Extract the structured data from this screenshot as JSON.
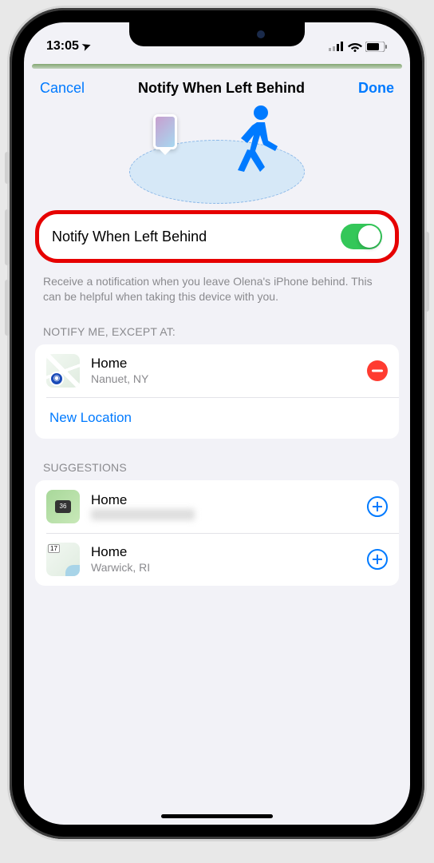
{
  "status": {
    "time": "13:05",
    "location_glyph": "➤"
  },
  "nav": {
    "cancel": "Cancel",
    "title": "Notify When Left Behind",
    "done": "Done"
  },
  "main_toggle": {
    "label": "Notify When Left Behind",
    "on": true
  },
  "helper_text": "Receive a notification when you leave Olena's iPhone behind. This can be helpful when taking this device with you.",
  "sections": {
    "except_header": "NOTIFY ME, EXCEPT AT:",
    "suggestions_header": "SUGGESTIONS"
  },
  "except": [
    {
      "title": "Home",
      "subtitle": "Nanuet, NY"
    }
  ],
  "new_location_label": "New Location",
  "suggestions": [
    {
      "title": "Home",
      "subtitle_hidden": true
    },
    {
      "title": "Home",
      "subtitle": "Warwick, RI"
    }
  ]
}
